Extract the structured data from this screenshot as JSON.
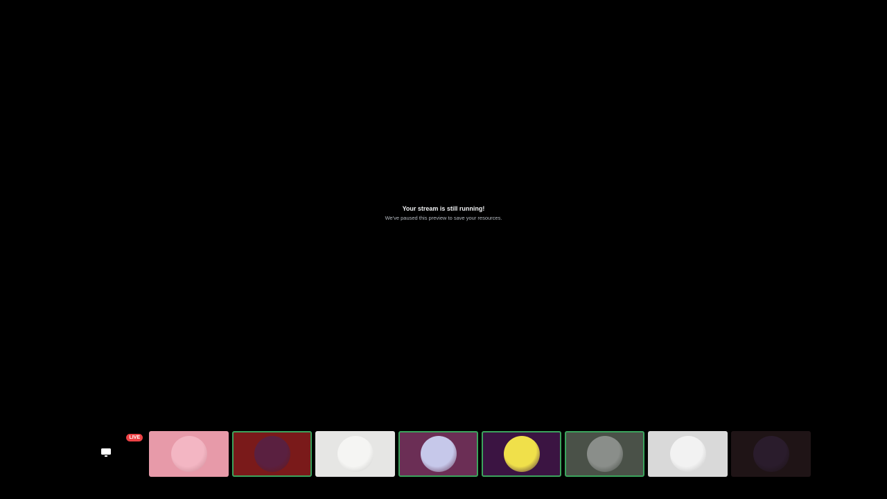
{
  "preview": {
    "title": "Your stream is still running!",
    "subtitle": "We've paused this preview to save your resources."
  },
  "self_tile": {
    "badge": "LIVE",
    "icon": "screen-share-icon"
  },
  "participants": [
    {
      "bg": "#e79aa9",
      "avatar_color": "#f3b6c3",
      "speaking": false
    },
    {
      "bg": "#7a1a1a",
      "avatar_color": "#5a2040",
      "speaking": true
    },
    {
      "bg": "#e6e6e4",
      "avatar_color": "#f5f5f3",
      "speaking": false
    },
    {
      "bg": "#6b2e55",
      "avatar_color": "#c6c8ea",
      "speaking": true
    },
    {
      "bg": "#3b1442",
      "avatar_color": "#f0e04a",
      "speaking": true
    },
    {
      "bg": "#4a5148",
      "avatar_color": "#8a8e8a",
      "speaking": true
    },
    {
      "bg": "#d9d9d9",
      "avatar_color": "#f2f2f2",
      "speaking": false
    },
    {
      "bg": "#1f1416",
      "avatar_color": "#2a1c2c",
      "speaking": false
    }
  ],
  "colors": {
    "background": "#000000",
    "live_badge": "#ed4245",
    "speaking_ring": "#3ba55d"
  }
}
